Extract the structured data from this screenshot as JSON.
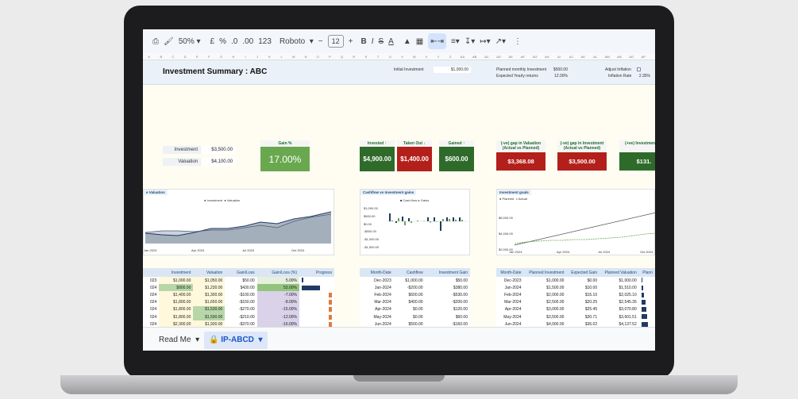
{
  "toolbar": {
    "zoom": "50%",
    "currency": "£",
    "percent": "%",
    "dec_less": ".0",
    "dec_more": ".00",
    "number_format": "123",
    "font": "Roboto",
    "font_size": "12",
    "bold": "B",
    "italic": "I",
    "strike": "S",
    "text_color": "A"
  },
  "columns": [
    "A",
    "B",
    "C",
    "D",
    "E",
    "F",
    "G",
    "H",
    "I",
    "J",
    "K",
    "L",
    "M",
    "N",
    "O",
    "P",
    "Q",
    "R",
    "S",
    "T",
    "U",
    "V",
    "W",
    "X",
    "Y",
    "Z",
    "AA",
    "AB",
    "AC",
    "AD",
    "AE",
    "AF",
    "AG",
    "AH",
    "AI",
    "AJ",
    "AK",
    "AL",
    "AM",
    "AN",
    "AO",
    "AP"
  ],
  "header": {
    "title": "Investment Summary : ABC",
    "initial_investment_label": "Initial Investment",
    "initial_investment": "$1,000.00",
    "planned_monthly_label": "Planned monthly Investment",
    "planned_monthly": "$500.00",
    "expected_returns_label": "Expected Yearly returns",
    "expected_returns": "12.00%",
    "adjust_inflation_label": "Adjust Inflation",
    "inflation_rate_label": "Inflation Rate",
    "inflation_rate": "2.35%"
  },
  "summary": {
    "investment_label": "Investment",
    "investment": "$3,500.00",
    "valuation_label": "Valuation",
    "valuation": "$4,100.00",
    "gain_label": "Gain %",
    "gain": "17.00%"
  },
  "cards": [
    {
      "label": "Invested ↑",
      "value": "$4,900.00",
      "color": "#2e6b2a"
    },
    {
      "label": "Taken Out ↓",
      "value": "$1,400.00",
      "color": "#b3201b"
    },
    {
      "label": "Gained ↑",
      "value": "$600.00",
      "color": "#2e6b2a"
    }
  ],
  "gap_cards": [
    {
      "label1": "(-ve) gap in Valuation",
      "label2": "(Actual vs Planned)",
      "value": "$3,368.08",
      "color": "#b3201b"
    },
    {
      "label1": "(-ve) gap in Investment",
      "label2": "(Actual vs Planned)",
      "value": "$3,500.00",
      "color": "#b3201b"
    },
    {
      "label1": "(+ve) Investment Ga",
      "label2": "",
      "value": "$131.",
      "color": "#2e6b2a"
    }
  ],
  "chart1": {
    "title": "e Valuation",
    "legend": [
      "Investment",
      "Valuation"
    ],
    "xticks": [
      "Jan 2024",
      "Apr 2024",
      "Jul 2024",
      "Oct 2024"
    ]
  },
  "chart2": {
    "title": "Cashflow vs Investment gains",
    "legend": [
      "Cash flow",
      "Gains"
    ],
    "yticks": [
      "$1,000.00",
      "$500.00",
      "$0.00",
      "-$500.00",
      "-$1,000.00",
      "-$1,500.00"
    ]
  },
  "chart3": {
    "title": "Investment goals",
    "legend": [
      "Planned",
      "Actual"
    ],
    "yticks": [
      "$6,000.00",
      "$4,000.00",
      "$2,000.00"
    ],
    "xticks": [
      "Jan 2024",
      "Apr 2024",
      "Jul 2024",
      "Oct 2024"
    ]
  },
  "table1": {
    "headers": [
      "",
      "Investment",
      "Valuation",
      "Gain/Loss",
      "Gain/Loss (%)",
      "Progress"
    ],
    "rows": [
      [
        "023",
        "$1,000.00",
        "$1,050.00",
        "$50.00",
        "5.00%",
        0.05,
        ""
      ],
      [
        "024",
        "$800.00",
        "$1,230.00",
        "$430.00",
        "53.00%",
        0.53,
        ""
      ],
      [
        "024",
        "$1,400.00",
        "$1,300.00",
        "-$100.00",
        "-7.00%",
        0,
        "o"
      ],
      [
        "024",
        "$1,800.00",
        "$1,650.00",
        "-$150.00",
        "-8.00%",
        0,
        "o"
      ],
      [
        "024",
        "$1,800.00",
        "$1,530.00",
        "-$270.00",
        "-15.00%",
        0,
        "o"
      ],
      [
        "024",
        "$1,800.00",
        "$1,590.00",
        "-$210.00",
        "-12.00%",
        0,
        "o"
      ],
      [
        "024",
        "$2,300.00",
        "$1,930.00",
        "-$370.00",
        "-16.00%",
        0,
        "o"
      ],
      [
        "024",
        "$2,800.00",
        "$2,340.00",
        "-$460.00",
        "-16.00%",
        0,
        "o"
      ],
      [
        "024",
        "$1,600.00",
        "$1,450.00",
        "-$150.00",
        "-9.00%",
        0,
        "o"
      ],
      [
        "024",
        "$2,100.00",
        "$2,250.00",
        "$150.00",
        "7.00%",
        0.07,
        ""
      ],
      [
        "024",
        "$2,600.00",
        "$2,970.00",
        "$370.00",
        "14.00%",
        0.14,
        ""
      ]
    ]
  },
  "table2": {
    "headers": [
      "Month-Date",
      "Cashflow",
      "Investment Gain"
    ],
    "rows": [
      [
        "Dec-2023",
        "$1,000.00",
        "$50.00"
      ],
      [
        "Jan-2024",
        "-$200.00",
        "$380.00"
      ],
      [
        "Feb-2024",
        "$600.00",
        "-$530.00"
      ],
      [
        "Mar-2024",
        "$400.00",
        "-$200.00"
      ],
      [
        "Apr-2024",
        "$0.00",
        "$120.00"
      ],
      [
        "May-2024",
        "$0.00",
        "$60.00"
      ],
      [
        "Jun-2024",
        "$500.00",
        "-$160.00"
      ],
      [
        "Jul-2024",
        "$500.00",
        "-$60.00"
      ],
      [
        "Aug-2024",
        "-$1,200.00",
        "$310.00"
      ],
      [
        "Sep-2024",
        "$500.00",
        "$300.00"
      ],
      [
        "Oct-2024",
        "$500.00",
        "$220.00"
      ]
    ]
  },
  "table3": {
    "headers": [
      "Month-Date",
      "Planned Investment",
      "Expected Gain",
      "Planned Valuation",
      "Plann"
    ],
    "rows": [
      [
        "Dec-2023",
        "$1,000.00",
        "$0.00",
        "$1,000.00",
        0.1
      ],
      [
        "Jan-2024",
        "$1,500.00",
        "$10.00",
        "$1,510.00",
        0.2
      ],
      [
        "Feb-2024",
        "$2,000.00",
        "$15.10",
        "$2,025.10",
        0.3
      ],
      [
        "Mar-2024",
        "$2,500.00",
        "$20.25",
        "$2,545.35",
        0.4
      ],
      [
        "Apr-2024",
        "$3,000.00",
        "$25.45",
        "$3,070.80",
        0.5
      ],
      [
        "May-2024",
        "$3,500.00",
        "$30.71",
        "$3,601.51",
        0.6
      ],
      [
        "Jun-2024",
        "$4,000.00",
        "$36.02",
        "$4,137.52",
        0.7
      ],
      [
        "Jul-2024",
        "$4,500.00",
        "$41.38",
        "$4,678.90",
        0.8
      ],
      [
        "Aug-2024",
        "$5,000.00",
        "$46.79",
        "$5,225.69",
        0.9
      ],
      [
        "Sep-2024",
        "$5,500.00",
        "$52.26",
        "$5,777.94",
        1.0
      ],
      [
        "Oct-2024",
        "$6,000.00",
        "$57.78",
        "$6,335.73",
        1.0
      ]
    ]
  },
  "tabs": {
    "read_me": "Read Me",
    "active": "IP-ABCD"
  }
}
